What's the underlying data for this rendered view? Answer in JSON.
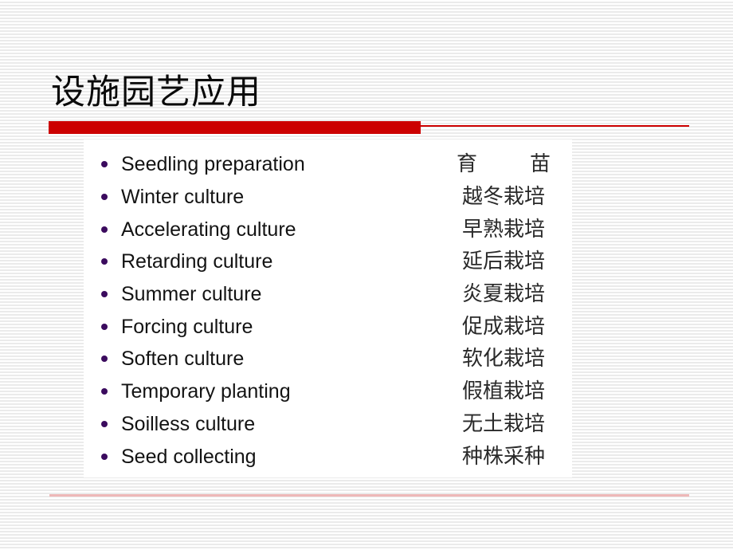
{
  "slide": {
    "title": "设施园艺应用",
    "accent_color": "#cc0000",
    "bullet_color": "#3b0b5e",
    "footer_rule_color": "#eeb8b8",
    "background_stripe_color": "#ebebeb"
  },
  "list": {
    "rows": [
      {
        "en": "Seedling preparation",
        "zh": "育　　苗",
        "zh_spread": true,
        "zh_chars": [
          "育",
          "苗"
        ]
      },
      {
        "en": "Winter culture",
        "zh": "越冬栽培",
        "zh_spread": false
      },
      {
        "en": "Accelerating culture",
        "zh": "早熟栽培",
        "zh_spread": false
      },
      {
        "en": "Retarding culture",
        "zh": "延后栽培",
        "zh_spread": false
      },
      {
        "en": "Summer culture",
        "zh": "炎夏栽培",
        "zh_spread": false
      },
      {
        "en": "Forcing culture",
        "zh": "促成栽培",
        "zh_spread": false
      },
      {
        "en": "Soften culture",
        "zh": "软化栽培",
        "zh_spread": false
      },
      {
        "en": "Temporary planting",
        "zh": "假植栽培",
        "zh_spread": false
      },
      {
        "en": "Soilless culture",
        "zh": "无土栽培",
        "zh_spread": false
      },
      {
        "en": "Seed collecting",
        "zh": "种株采种",
        "zh_spread": false
      }
    ]
  }
}
